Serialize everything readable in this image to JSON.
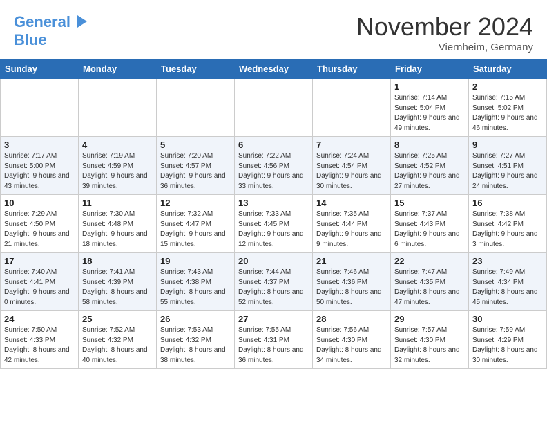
{
  "header": {
    "logo_line1": "General",
    "logo_line2": "Blue",
    "month_title": "November 2024",
    "location": "Viernheim, Germany"
  },
  "weekdays": [
    "Sunday",
    "Monday",
    "Tuesday",
    "Wednesday",
    "Thursday",
    "Friday",
    "Saturday"
  ],
  "weeks": [
    [
      {
        "day": "",
        "info": ""
      },
      {
        "day": "",
        "info": ""
      },
      {
        "day": "",
        "info": ""
      },
      {
        "day": "",
        "info": ""
      },
      {
        "day": "",
        "info": ""
      },
      {
        "day": "1",
        "info": "Sunrise: 7:14 AM\nSunset: 5:04 PM\nDaylight: 9 hours and 49 minutes."
      },
      {
        "day": "2",
        "info": "Sunrise: 7:15 AM\nSunset: 5:02 PM\nDaylight: 9 hours and 46 minutes."
      }
    ],
    [
      {
        "day": "3",
        "info": "Sunrise: 7:17 AM\nSunset: 5:00 PM\nDaylight: 9 hours and 43 minutes."
      },
      {
        "day": "4",
        "info": "Sunrise: 7:19 AM\nSunset: 4:59 PM\nDaylight: 9 hours and 39 minutes."
      },
      {
        "day": "5",
        "info": "Sunrise: 7:20 AM\nSunset: 4:57 PM\nDaylight: 9 hours and 36 minutes."
      },
      {
        "day": "6",
        "info": "Sunrise: 7:22 AM\nSunset: 4:56 PM\nDaylight: 9 hours and 33 minutes."
      },
      {
        "day": "7",
        "info": "Sunrise: 7:24 AM\nSunset: 4:54 PM\nDaylight: 9 hours and 30 minutes."
      },
      {
        "day": "8",
        "info": "Sunrise: 7:25 AM\nSunset: 4:52 PM\nDaylight: 9 hours and 27 minutes."
      },
      {
        "day": "9",
        "info": "Sunrise: 7:27 AM\nSunset: 4:51 PM\nDaylight: 9 hours and 24 minutes."
      }
    ],
    [
      {
        "day": "10",
        "info": "Sunrise: 7:29 AM\nSunset: 4:50 PM\nDaylight: 9 hours and 21 minutes."
      },
      {
        "day": "11",
        "info": "Sunrise: 7:30 AM\nSunset: 4:48 PM\nDaylight: 9 hours and 18 minutes."
      },
      {
        "day": "12",
        "info": "Sunrise: 7:32 AM\nSunset: 4:47 PM\nDaylight: 9 hours and 15 minutes."
      },
      {
        "day": "13",
        "info": "Sunrise: 7:33 AM\nSunset: 4:45 PM\nDaylight: 9 hours and 12 minutes."
      },
      {
        "day": "14",
        "info": "Sunrise: 7:35 AM\nSunset: 4:44 PM\nDaylight: 9 hours and 9 minutes."
      },
      {
        "day": "15",
        "info": "Sunrise: 7:37 AM\nSunset: 4:43 PM\nDaylight: 9 hours and 6 minutes."
      },
      {
        "day": "16",
        "info": "Sunrise: 7:38 AM\nSunset: 4:42 PM\nDaylight: 9 hours and 3 minutes."
      }
    ],
    [
      {
        "day": "17",
        "info": "Sunrise: 7:40 AM\nSunset: 4:41 PM\nDaylight: 9 hours and 0 minutes."
      },
      {
        "day": "18",
        "info": "Sunrise: 7:41 AM\nSunset: 4:39 PM\nDaylight: 8 hours and 58 minutes."
      },
      {
        "day": "19",
        "info": "Sunrise: 7:43 AM\nSunset: 4:38 PM\nDaylight: 8 hours and 55 minutes."
      },
      {
        "day": "20",
        "info": "Sunrise: 7:44 AM\nSunset: 4:37 PM\nDaylight: 8 hours and 52 minutes."
      },
      {
        "day": "21",
        "info": "Sunrise: 7:46 AM\nSunset: 4:36 PM\nDaylight: 8 hours and 50 minutes."
      },
      {
        "day": "22",
        "info": "Sunrise: 7:47 AM\nSunset: 4:35 PM\nDaylight: 8 hours and 47 minutes."
      },
      {
        "day": "23",
        "info": "Sunrise: 7:49 AM\nSunset: 4:34 PM\nDaylight: 8 hours and 45 minutes."
      }
    ],
    [
      {
        "day": "24",
        "info": "Sunrise: 7:50 AM\nSunset: 4:33 PM\nDaylight: 8 hours and 42 minutes."
      },
      {
        "day": "25",
        "info": "Sunrise: 7:52 AM\nSunset: 4:32 PM\nDaylight: 8 hours and 40 minutes."
      },
      {
        "day": "26",
        "info": "Sunrise: 7:53 AM\nSunset: 4:32 PM\nDaylight: 8 hours and 38 minutes."
      },
      {
        "day": "27",
        "info": "Sunrise: 7:55 AM\nSunset: 4:31 PM\nDaylight: 8 hours and 36 minutes."
      },
      {
        "day": "28",
        "info": "Sunrise: 7:56 AM\nSunset: 4:30 PM\nDaylight: 8 hours and 34 minutes."
      },
      {
        "day": "29",
        "info": "Sunrise: 7:57 AM\nSunset: 4:30 PM\nDaylight: 8 hours and 32 minutes."
      },
      {
        "day": "30",
        "info": "Sunrise: 7:59 AM\nSunset: 4:29 PM\nDaylight: 8 hours and 30 minutes."
      }
    ]
  ]
}
